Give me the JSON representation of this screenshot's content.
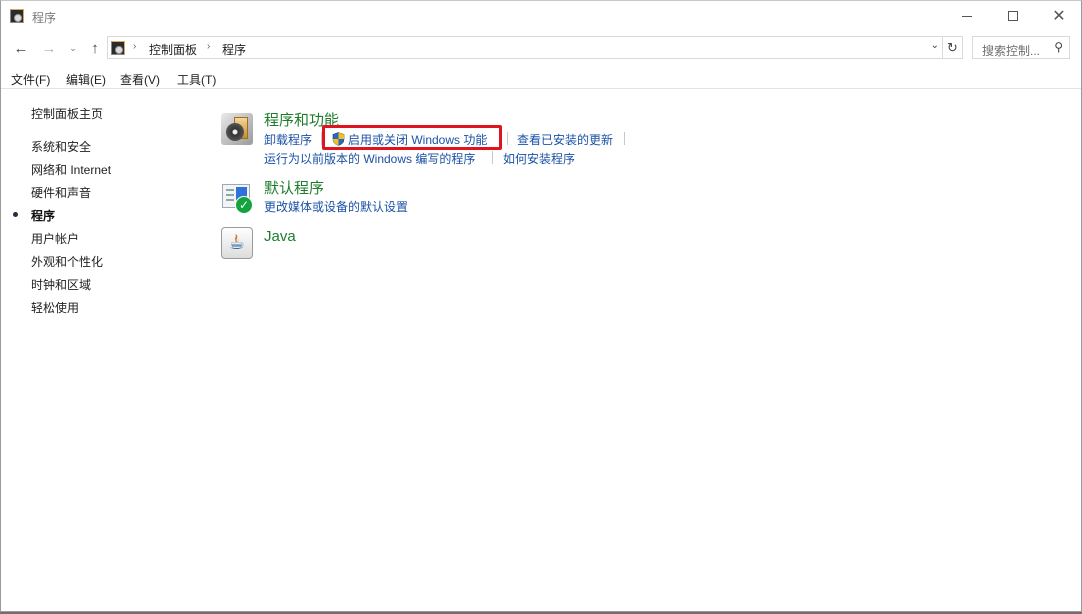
{
  "window": {
    "title": "程序",
    "controls": {
      "minimize": "minimize",
      "maximize": "maximize",
      "close": "close"
    }
  },
  "address": {
    "breadcrumb": [
      "控制面板",
      "程序"
    ],
    "search_placeholder": "搜索控制..."
  },
  "menu": [
    {
      "label": "文件(F)"
    },
    {
      "label": "编辑(E)"
    },
    {
      "label": "查看(V)"
    },
    {
      "label": "工具(T)"
    }
  ],
  "sidebar": {
    "home": "控制面板主页",
    "items": [
      {
        "label": "系统和安全",
        "active": false
      },
      {
        "label": "网络和 Internet",
        "active": false
      },
      {
        "label": "硬件和声音",
        "active": false
      },
      {
        "label": "程序",
        "active": true
      },
      {
        "label": "用户帐户",
        "active": false
      },
      {
        "label": "外观和个性化",
        "active": false
      },
      {
        "label": "时钟和区域",
        "active": false
      },
      {
        "label": "轻松使用",
        "active": false
      }
    ]
  },
  "categories": [
    {
      "title": "程序和功能",
      "icon": "programs-features-icon",
      "links": [
        "卸载程序",
        "启用或关闭 Windows 功能",
        "查看已安装的更新",
        "运行为以前版本的 Windows 编写的程序",
        "如何安装程序"
      ]
    },
    {
      "title": "默认程序",
      "icon": "default-programs-icon",
      "links": [
        "更改媒体或设备的默认设置"
      ]
    },
    {
      "title": "Java",
      "icon": "java-icon",
      "links": []
    }
  ],
  "highlight": {
    "target": "启用或关闭 Windows 功能",
    "color": "#e0141e"
  },
  "colors": {
    "category_title": "#1e7d2d",
    "link": "#1a52a5"
  }
}
